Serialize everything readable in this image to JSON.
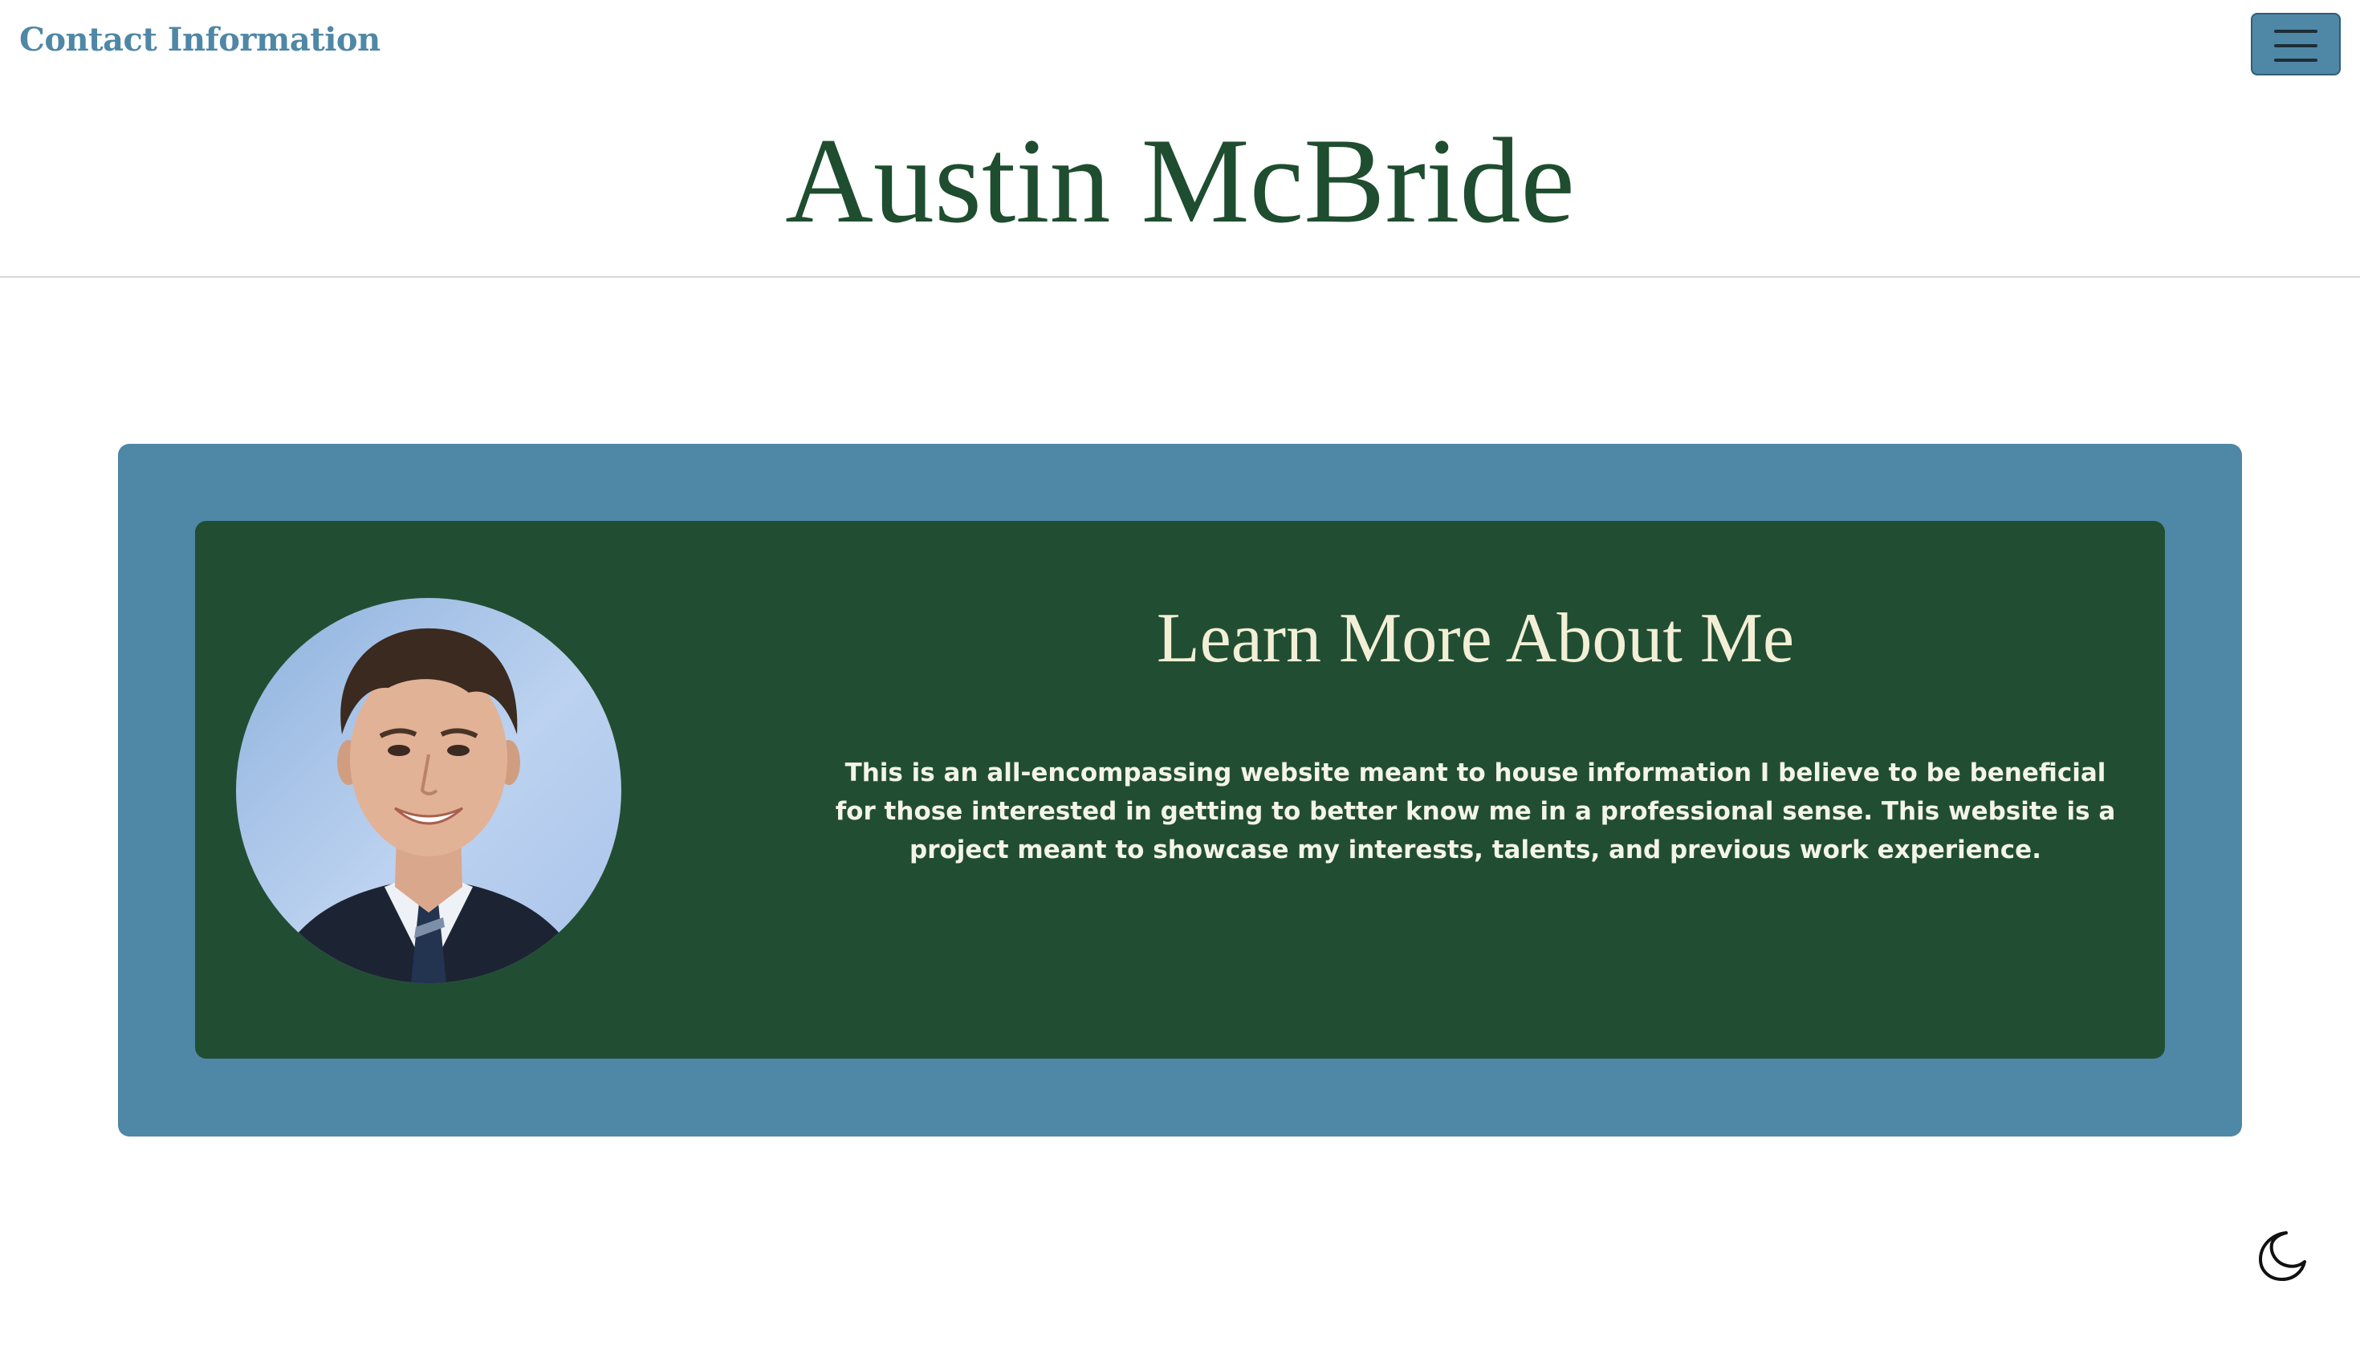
{
  "nav": {
    "contact_link": "Contact Information",
    "menu_icon": "hamburger-menu-icon"
  },
  "header": {
    "title": "Austin McBride"
  },
  "about": {
    "heading": "Learn More About Me",
    "description": "This is an all-encompassing website meant to house information I believe to be beneficial for those interested in getting to better know me in a professional sense. This website is a project meant to showcase my interests, talents, and previous work experience.",
    "photo": "profile-photo"
  },
  "theme": {
    "toggle_icon": "moon-icon"
  },
  "colors": {
    "accent_blue": "#4f87a6",
    "forest_green": "#214e32",
    "title_green": "#1f4d2f",
    "heading_cream": "#f3efd6"
  }
}
